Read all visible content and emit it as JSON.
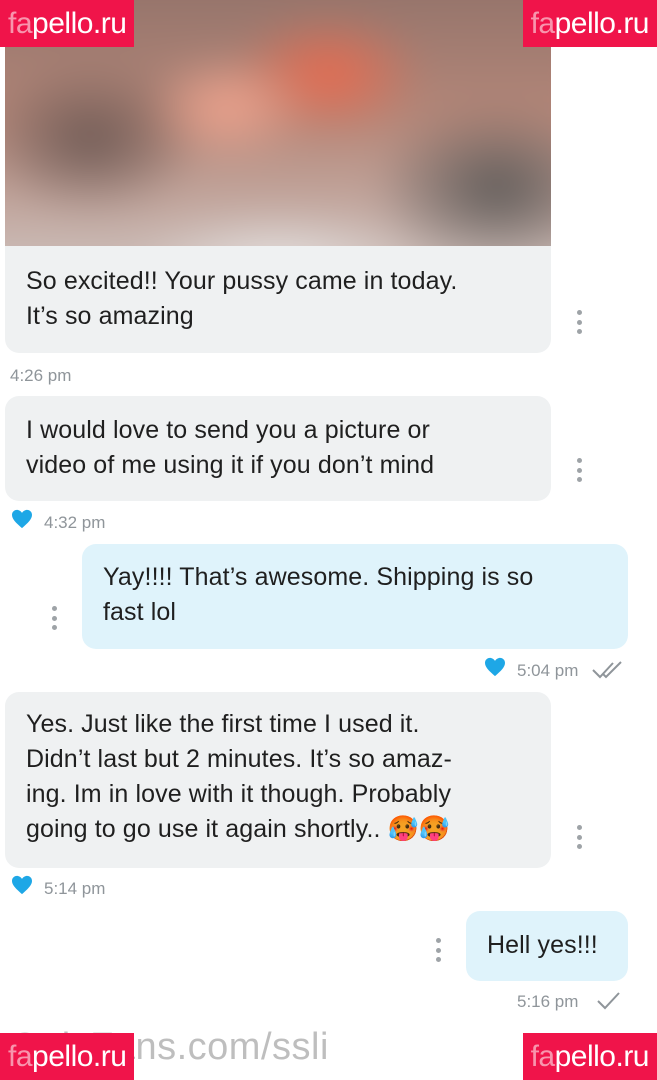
{
  "watermark": {
    "prefix": "fa",
    "suffix": "pello.ru",
    "bottom_text": "OnlyFans.com/ssli"
  },
  "messages": [
    {
      "direction": "incoming",
      "image": "blurred-photo",
      "lines": [
        "So excited!! Your pussy came in today.",
        "It’s so amazing"
      ],
      "time": "4:26 pm"
    },
    {
      "direction": "incoming",
      "lines": [
        "I would love to send you a picture or",
        "video of me using it if you don’t mind"
      ],
      "liked": true,
      "time": "4:32 pm"
    },
    {
      "direction": "outgoing",
      "lines": [
        "Yay!!!! That’s awesome. Shipping is so",
        "fast lol"
      ],
      "liked": true,
      "time": "5:04 pm",
      "status": "double-check-icon"
    },
    {
      "direction": "incoming",
      "lines": [
        "Yes. Just like the first time I used it.",
        "Didn’t last but 2 minutes. It’s so amaz-",
        "ing. Im in love with it though. Probably",
        "going to go use it again shortly.. 🥵🥵"
      ],
      "liked": true,
      "time": "5:14 pm"
    },
    {
      "direction": "outgoing",
      "lines": [
        "Hell yes!!!"
      ],
      "time": "5:16 pm",
      "status": "check-icon"
    }
  ],
  "colors": {
    "incoming_bubble": "#eff1f2",
    "outgoing_bubble": "#dff3fb",
    "heart": "#1ea7e6",
    "watermark": "#f0144a"
  }
}
